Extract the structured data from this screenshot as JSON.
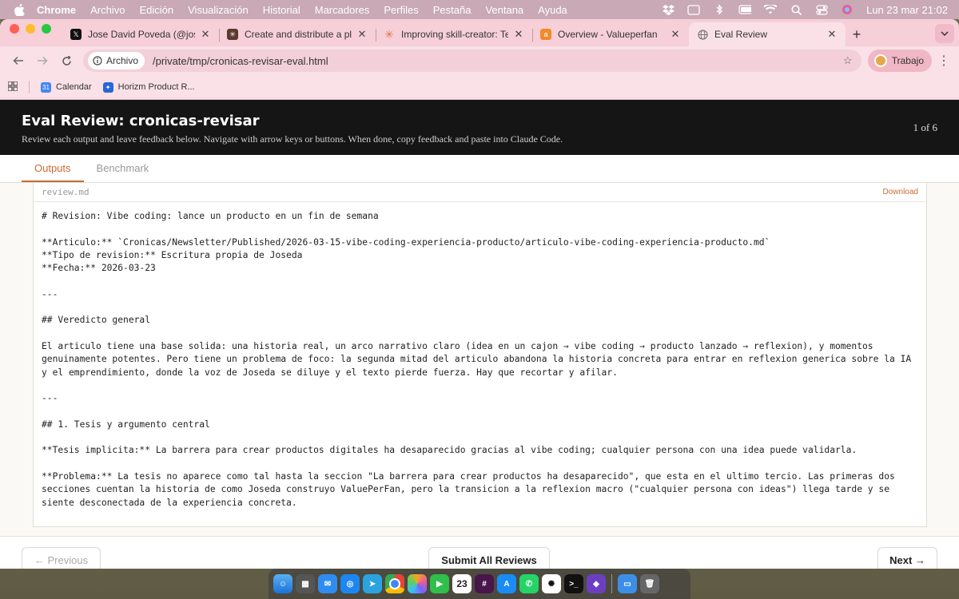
{
  "menubar": {
    "items": [
      "Chrome",
      "Archivo",
      "Edición",
      "Visualización",
      "Historial",
      "Marcadores",
      "Perfiles",
      "Pestaña",
      "Ventana",
      "Ayuda"
    ],
    "clock": "Lun 23 mar 21:02"
  },
  "tabs": [
    {
      "label": "Jose David Poveda (@josedap",
      "icon": "x-logo-icon",
      "color": "#111111"
    },
    {
      "label": "Create and distribute a plugin",
      "icon": "claude-icon",
      "color": "#5b3a2e"
    },
    {
      "label": "Improving skill-creator: Test,",
      "icon": "anthropic-star-icon",
      "color": "#d9774b"
    },
    {
      "label": "Overview - Valueperfan",
      "icon": "valueperfan-icon",
      "color": "#f08b2a"
    },
    {
      "label": "Eval Review",
      "icon": "globe-icon",
      "color": "#777777"
    }
  ],
  "toolbar": {
    "chip_label": "Archivo",
    "url": "/private/tmp/cronicas-revisar-eval.html",
    "profile_label": "Trabajo"
  },
  "bookmarks": [
    {
      "label": "Calendar",
      "color": "#4285f4"
    },
    {
      "label": "Horizm Product R...",
      "color": "#2a66d9"
    }
  ],
  "page": {
    "title": "Eval Review: cronicas-revisar",
    "subtitle": "Review each output and leave feedback below. Navigate with arrow keys or buttons. When done, copy feedback and paste into Claude Code.",
    "counter": "1 of 6",
    "tabs": [
      "Outputs",
      "Benchmark"
    ],
    "file": {
      "name": "review.md",
      "download_label": "Download",
      "lines": [
        "# Revision: Vibe coding: lance un producto en un fin de semana",
        "",
        "**Articulo:** `Cronicas/Newsletter/Published/2026-03-15-vibe-coding-experiencia-producto/articulo-vibe-coding-experiencia-producto.md`",
        "**Tipo de revision:** Escritura propia de Joseda",
        "**Fecha:** 2026-03-23",
        "",
        "---",
        "",
        "## Veredicto general",
        "",
        "El articulo tiene una base solida: una historia real, un arco narrativo claro (idea en un cajon → vibe coding → producto lanzado → reflexion), y momentos genuinamente potentes. Pero tiene un problema de foco: la segunda mitad del articulo abandona la historia concreta para entrar en reflexion generica sobre la IA y el emprendimiento, donde la voz de Joseda se diluye y el texto pierde fuerza. Hay que recortar y afilar.",
        "",
        "---",
        "",
        "## 1. Tesis y argumento central",
        "",
        "**Tesis implicita:** La barrera para crear productos digitales ha desaparecido gracias al vibe coding; cualquier persona con una idea puede validarla.",
        "",
        "**Problema:** La tesis no aparece como tal hasta la seccion \"La barrera para crear productos ha desaparecido\", que esta en el ultimo tercio. Las primeras dos secciones cuentan la historia de como Joseda construyo ValuePerFan, pero la transicion a la reflexion macro (\"cualquier persona con ideas\") llega tarde y se siente desconectada de la experiencia concreta."
      ]
    },
    "footer": {
      "prev_label": "← Previous",
      "submit_label": "Submit All Reviews",
      "next_label": "Next →"
    }
  },
  "dock": {
    "calendar_day": "23",
    "apps": [
      "finder",
      "launchpad",
      "mail",
      "safari",
      "telegram",
      "chrome",
      "photos",
      "facetime",
      "calendar",
      "slack",
      "app-store",
      "whatsapp",
      "chatgpt",
      "terminal",
      "obsidian"
    ]
  }
}
